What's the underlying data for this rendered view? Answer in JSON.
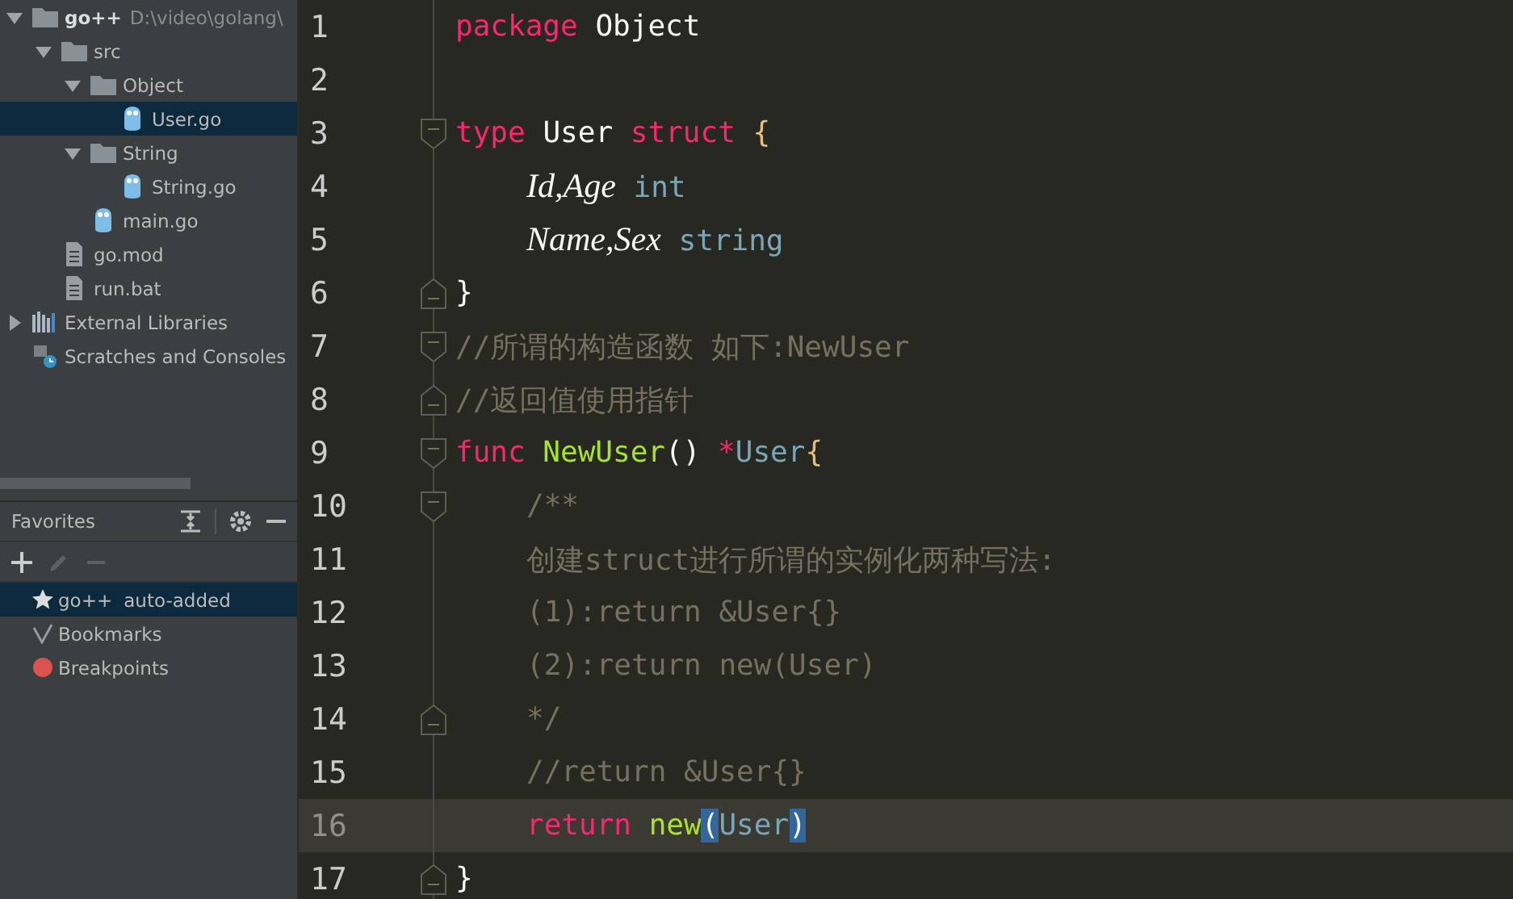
{
  "project_tree": [
    {
      "label": "go++",
      "detail": "D:\\video\\golang\\",
      "kind": "folder",
      "expanded": true,
      "selected": false,
      "children": [
        {
          "label": "src",
          "kind": "folder",
          "expanded": true,
          "selected": false,
          "children": [
            {
              "label": "Object",
              "kind": "folder",
              "expanded": true,
              "selected": false,
              "children": [
                {
                  "label": "User.go",
                  "kind": "go",
                  "selected": true
                }
              ]
            },
            {
              "label": "String",
              "kind": "folder",
              "expanded": true,
              "selected": false,
              "children": [
                {
                  "label": "String.go",
                  "kind": "go",
                  "selected": false
                }
              ]
            },
            {
              "label": "main.go",
              "kind": "go",
              "selected": false
            }
          ]
        },
        {
          "label": "go.mod",
          "kind": "file",
          "selected": false
        },
        {
          "label": "run.bat",
          "kind": "file",
          "selected": false
        }
      ]
    },
    {
      "label": "External Libraries",
      "kind": "library",
      "expanded": false,
      "selected": false
    },
    {
      "label": "Scratches and Consoles",
      "kind": "scratches",
      "selected": false
    }
  ],
  "favorites": {
    "title": "Favorites",
    "items": [
      {
        "kind": "star",
        "label": "go++",
        "detail": "auto-added",
        "selected": true
      },
      {
        "kind": "check",
        "label": "Bookmarks",
        "selected": false
      },
      {
        "kind": "dot",
        "label": "Breakpoints",
        "selected": false
      }
    ]
  },
  "editor": {
    "lines": [
      {
        "number": "1",
        "current": false,
        "indented": false,
        "fold_start": false,
        "fold_end": false,
        "tokens": [
          {
            "kind": "keyword",
            "text": "package"
          },
          {
            "kind": "plain",
            "text": " Object"
          }
        ]
      },
      {
        "number": "2",
        "current": false,
        "fold_start": false,
        "fold_end": false
      },
      {
        "number": "3",
        "current": false,
        "indented": false,
        "fold_start": true,
        "fold_end": false,
        "tokens": [
          {
            "kind": "keyword",
            "text": "type"
          },
          {
            "kind": "plain",
            "text": " User "
          },
          {
            "kind": "keyword",
            "text": "struct"
          },
          {
            "kind": "brace",
            "text": "{",
            "space_before": true,
            "matched": false
          }
        ]
      },
      {
        "number": "4",
        "current": false,
        "indented": true,
        "fold_start": false,
        "fold_end": false,
        "tokens": [
          {
            "kind": "field",
            "text": "Id,Age"
          },
          {
            "kind": "type",
            "text": " int"
          }
        ]
      },
      {
        "number": "5",
        "current": false,
        "indented": true,
        "fold_start": false,
        "fold_end": false,
        "tokens": [
          {
            "kind": "field",
            "text": "Name,Sex"
          },
          {
            "kind": "type",
            "text": " string"
          }
        ]
      },
      {
        "number": "6",
        "current": false,
        "indented": false,
        "fold_start": false,
        "fold_end": true,
        "tokens": [
          {
            "kind": "plain",
            "text": "}"
          }
        ]
      },
      {
        "number": "7",
        "current": false,
        "indented": false,
        "fold_start": true,
        "fold_end": false,
        "tokens": [
          {
            "kind": "comment",
            "text": "//所谓的构造函数 如下:NewUser"
          }
        ]
      },
      {
        "number": "8",
        "current": false,
        "indented": false,
        "fold_start": false,
        "fold_end": true,
        "tokens": [
          {
            "kind": "comment",
            "text": "//返回值使用指针"
          }
        ]
      },
      {
        "number": "9",
        "current": false,
        "indented": false,
        "fold_start": true,
        "fold_end": false,
        "tokens": [
          {
            "kind": "keyword",
            "text": "func"
          },
          {
            "kind": "func",
            "text": "NewUser",
            "space_before": true
          },
          {
            "kind": "plain",
            "text": "() "
          },
          {
            "kind": "keyword",
            "text": "*"
          },
          {
            "kind": "type",
            "text": "User"
          },
          {
            "kind": "brace",
            "text": "{",
            "matched": false
          }
        ]
      },
      {
        "number": "10",
        "current": false,
        "indented": true,
        "fold_start": true,
        "fold_end": false,
        "tokens": [
          {
            "kind": "comment",
            "text": "/**"
          }
        ]
      },
      {
        "number": "11",
        "current": false,
        "indented": true,
        "fold_start": false,
        "fold_end": false,
        "tokens": [
          {
            "kind": "comment",
            "text": "创建struct进行所谓的实例化两种写法:"
          }
        ]
      },
      {
        "number": "12",
        "current": false,
        "indented": true,
        "fold_start": false,
        "fold_end": false,
        "tokens": [
          {
            "kind": "comment",
            "text": "(1):return &User{}"
          }
        ]
      },
      {
        "number": "13",
        "current": false,
        "indented": true,
        "fold_start": false,
        "fold_end": false,
        "tokens": [
          {
            "kind": "comment",
            "text": "(2):return new(User)"
          }
        ]
      },
      {
        "number": "14",
        "current": false,
        "indented": true,
        "fold_start": false,
        "fold_end": true,
        "tokens": [
          {
            "kind": "comment",
            "text": "*/"
          }
        ]
      },
      {
        "number": "15",
        "current": false,
        "indented": true,
        "fold_start": false,
        "fold_end": false,
        "tokens": [
          {
            "kind": "comment",
            "text": "//return &User{}"
          }
        ]
      },
      {
        "number": "16",
        "current": true,
        "indented": true,
        "fold_start": false,
        "fold_end": false,
        "tokens": [
          {
            "kind": "keyword",
            "text": "return"
          },
          {
            "kind": "func",
            "text": "new",
            "space_before": true
          },
          {
            "kind": "brace",
            "text": "(",
            "matched": true
          },
          {
            "kind": "type",
            "text": "User"
          },
          {
            "kind": "brace",
            "text": ")",
            "matched": true
          }
        ]
      },
      {
        "number": "17",
        "current": false,
        "indented": false,
        "fold_start": false,
        "fold_end": true,
        "tokens": [
          {
            "kind": "plain",
            "text": "}"
          }
        ]
      }
    ]
  }
}
